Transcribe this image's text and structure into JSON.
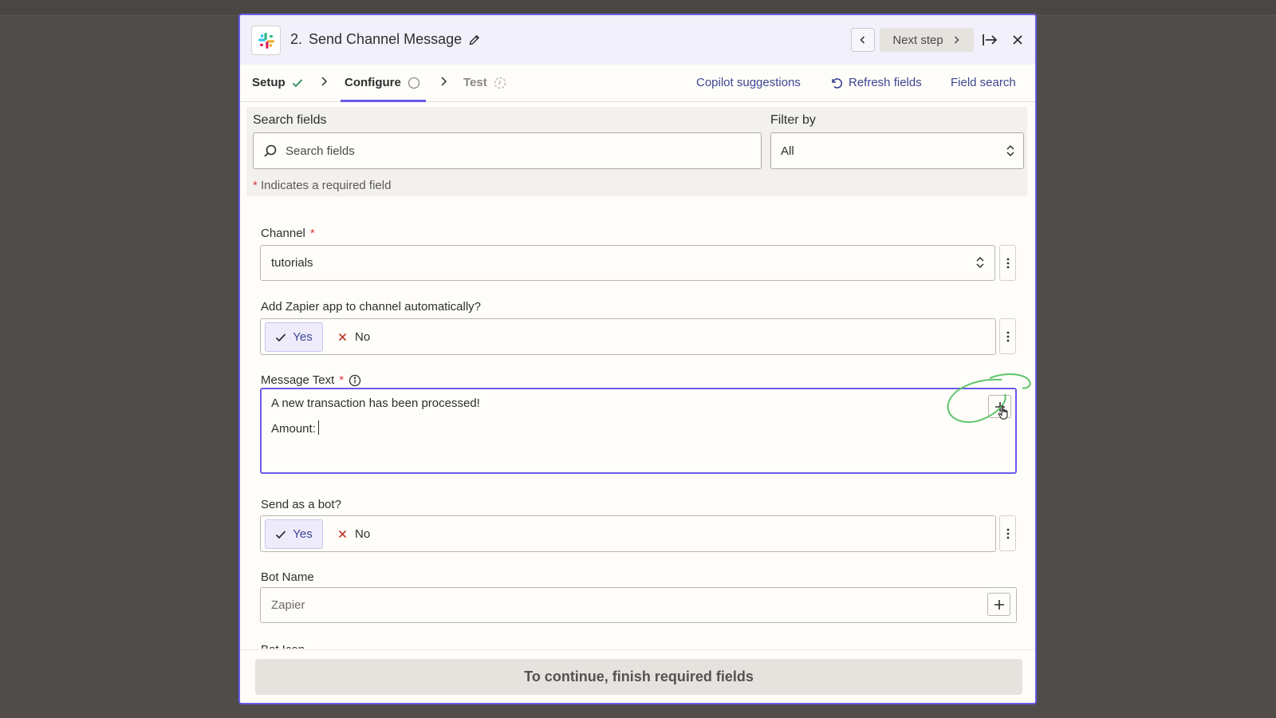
{
  "header": {
    "step_number": "2.",
    "title": "Send Channel Message",
    "next_step_label": "Next step",
    "app_icon": "slack-logo"
  },
  "tabs": {
    "setup": "Setup",
    "configure": "Configure",
    "test": "Test",
    "copilot": "Copilot suggestions",
    "refresh": "Refresh fields",
    "field_search": "Field search"
  },
  "filters": {
    "search_label": "Search fields",
    "search_placeholder": "Search fields",
    "filter_label": "Filter by",
    "filter_value": "All",
    "required_star": "*",
    "required_note": "Indicates a required field"
  },
  "fields": {
    "channel": {
      "label": "Channel",
      "star": "*",
      "value": "tutorials"
    },
    "add_app": {
      "label": "Add Zapier app to channel automatically?",
      "yes": "Yes",
      "no": "No",
      "selected": "Yes"
    },
    "message": {
      "label": "Message Text",
      "star": "*",
      "line1": "A new transaction has been processed!",
      "line2": "Amount:"
    },
    "as_bot": {
      "label": "Send as a bot?",
      "yes": "Yes",
      "no": "No",
      "selected": "Yes"
    },
    "bot_name": {
      "label": "Bot Name",
      "placeholder": "Zapier"
    },
    "bot_icon": {
      "label": "Bot Icon"
    }
  },
  "footer": {
    "continue_label": "To continue, finish required fields"
  },
  "colors": {
    "accent": "#695be8",
    "link": "#3d4592",
    "required": "#d93b3b",
    "annotation": "#5cc46a"
  }
}
